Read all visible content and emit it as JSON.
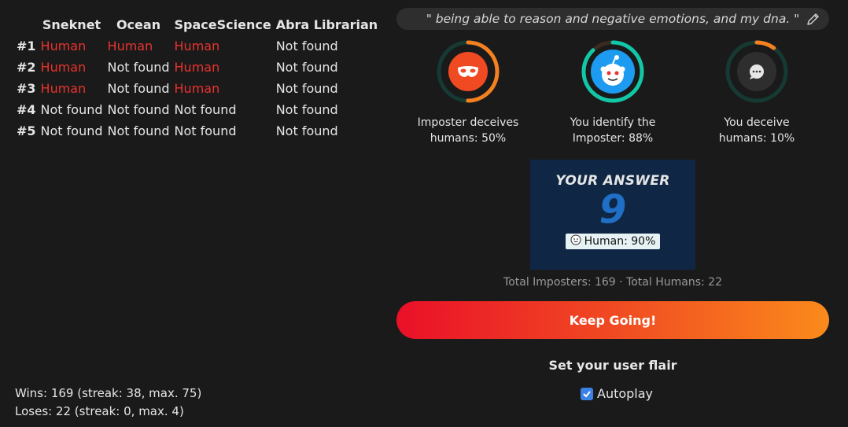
{
  "table": {
    "headers": [
      "Sneknet",
      "Ocean",
      "SpaceScience",
      "Abra Librarian"
    ],
    "rows": [
      {
        "rank": "#1",
        "cells": [
          {
            "text": "Human",
            "human": true
          },
          {
            "text": "Human",
            "human": true
          },
          {
            "text": "Human",
            "human": true
          },
          {
            "text": "Not found",
            "human": false
          }
        ]
      },
      {
        "rank": "#2",
        "cells": [
          {
            "text": "Human",
            "human": true
          },
          {
            "text": "Not found",
            "human": false
          },
          {
            "text": "Human",
            "human": true
          },
          {
            "text": "Not found",
            "human": false
          }
        ]
      },
      {
        "rank": "#3",
        "cells": [
          {
            "text": "Human",
            "human": true
          },
          {
            "text": "Not found",
            "human": false
          },
          {
            "text": "Human",
            "human": true
          },
          {
            "text": "Not found",
            "human": false
          }
        ]
      },
      {
        "rank": "#4",
        "cells": [
          {
            "text": "Not found",
            "human": false
          },
          {
            "text": "Not found",
            "human": false
          },
          {
            "text": "Not found",
            "human": false
          },
          {
            "text": "Not found",
            "human": false
          }
        ]
      },
      {
        "rank": "#5",
        "cells": [
          {
            "text": "Not found",
            "human": false
          },
          {
            "text": "Not found",
            "human": false
          },
          {
            "text": "Not found",
            "human": false
          },
          {
            "text": "Not found",
            "human": false
          }
        ]
      }
    ]
  },
  "stats": {
    "wins": "Wins: 169 (streak: 38, max. 75)",
    "loses": "Loses: 22 (streak: 0, max. 4)"
  },
  "quote": "\" being able to reason and negative emotions, and my dna. \"",
  "rings": [
    {
      "icon": "mask-icon",
      "line1": "Imposter deceives",
      "line2": "humans: 50%",
      "progress": 0.5,
      "color": "#f4801f",
      "icon_bg": "#f04a22"
    },
    {
      "icon": "snoo-icon",
      "line1": "You identify the",
      "line2": "Imposter: 88%",
      "progress": 0.88,
      "color": "#12c7a8",
      "icon_bg": "#1d9bf0"
    },
    {
      "icon": "chat-bubble-icon",
      "line1": "You deceive",
      "line2": "humans: 10%",
      "progress": 0.1,
      "color": "#f4801f",
      "icon_bg": "#2e2e2e"
    }
  ],
  "answer": {
    "title": "YOUR ANSWER",
    "number": "9",
    "badge": "Human: 90%"
  },
  "totals": "Total Imposters: 169 · Total Humans: 22",
  "keep_going_label": "Keep Going!",
  "flair_title": "Set your user flair",
  "autoplay": {
    "label": "Autoplay",
    "checked": true
  },
  "colors": {
    "human_red": "#e8332e",
    "ring_track": "#163a33",
    "answer_bg": "#0f2744",
    "answer_number": "#1f6fc6"
  }
}
